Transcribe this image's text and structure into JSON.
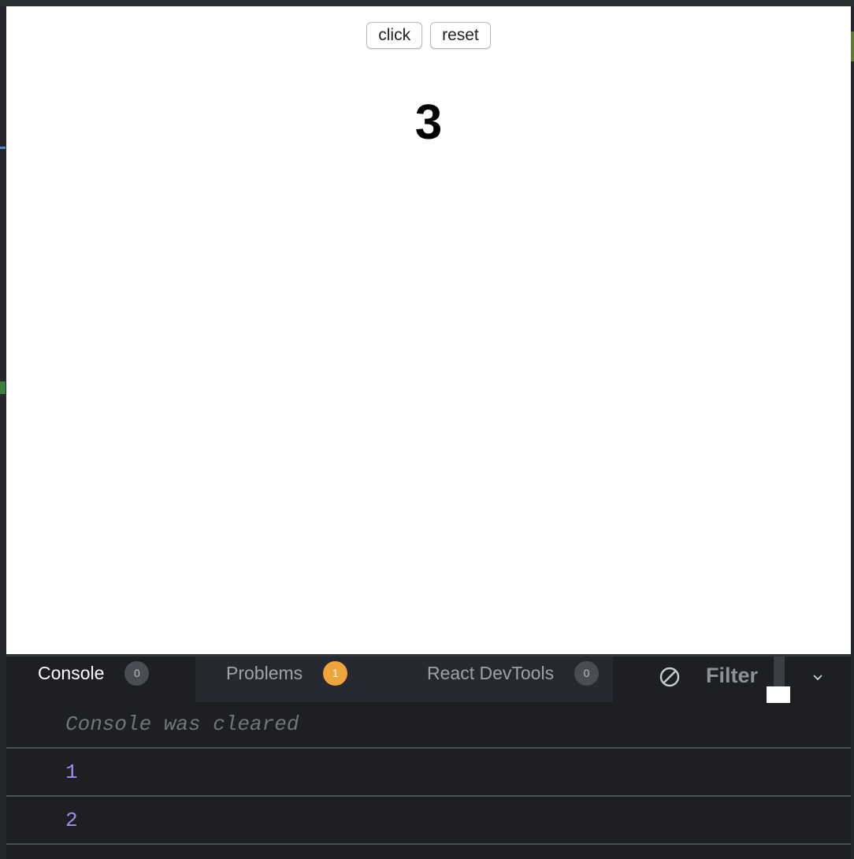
{
  "preview": {
    "buttons": {
      "click_label": "click",
      "reset_label": "reset"
    },
    "counter_value": "3"
  },
  "devtools": {
    "tabs": [
      {
        "label": "Console",
        "count": "0"
      },
      {
        "label": "Problems",
        "count": "1"
      },
      {
        "label": "React DevTools",
        "count": "0"
      }
    ],
    "filter_label": "Filter",
    "icons": {
      "clear": "clear-console-icon",
      "chevron": "chevron-down-icon"
    },
    "console_lines": {
      "cleared": "Console was cleared",
      "entries": [
        "1",
        "2"
      ]
    }
  },
  "colors": {
    "devtools_bg": "#1d1f23",
    "problems_badge": "#f0a43c",
    "log_number": "#a08cf0"
  }
}
